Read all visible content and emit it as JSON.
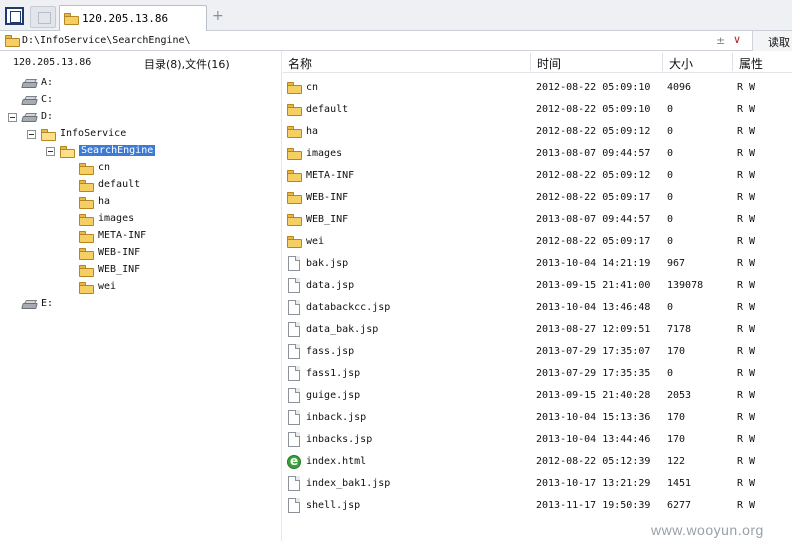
{
  "tabbar": {
    "tab_label": "120.205.13.86",
    "add_label": "+"
  },
  "address": {
    "path": "D:\\InfoService\\SearchEngine\\",
    "star": "±",
    "dropdown": "∨",
    "read_label": "读取"
  },
  "left": {
    "host": "120.205.13.86",
    "summary": "目录(8),文件(16)",
    "tree": [
      {
        "label": "A:",
        "type": "drive",
        "depth": 0,
        "expanded": false
      },
      {
        "label": "C:",
        "type": "drive",
        "depth": 0,
        "expanded": false
      },
      {
        "label": "D:",
        "type": "drive",
        "depth": 0,
        "expanded": true
      },
      {
        "label": "InfoService",
        "type": "folder",
        "depth": 1,
        "expanded": true
      },
      {
        "label": "SearchEngine",
        "type": "folder",
        "depth": 2,
        "expanded": true,
        "selected": true
      },
      {
        "label": "cn",
        "type": "folder",
        "depth": 3
      },
      {
        "label": "default",
        "type": "folder",
        "depth": 3
      },
      {
        "label": "ha",
        "type": "folder",
        "depth": 3
      },
      {
        "label": "images",
        "type": "folder",
        "depth": 3
      },
      {
        "label": "META-INF",
        "type": "folder",
        "depth": 3
      },
      {
        "label": "WEB-INF",
        "type": "folder",
        "depth": 3
      },
      {
        "label": "WEB_INF",
        "type": "folder",
        "depth": 3
      },
      {
        "label": "wei",
        "type": "folder",
        "depth": 3
      },
      {
        "label": "E:",
        "type": "drive",
        "depth": 0,
        "expanded": false
      }
    ]
  },
  "columns": {
    "name": "名称",
    "time": "时间",
    "size": "大小",
    "attr": "属性"
  },
  "files": [
    {
      "name": "cn",
      "type": "folder",
      "time": "2012-08-22 05:09:10",
      "size": "4096",
      "attr": "R W"
    },
    {
      "name": "default",
      "type": "folder",
      "time": "2012-08-22 05:09:10",
      "size": "0",
      "attr": "R W"
    },
    {
      "name": "ha",
      "type": "folder",
      "time": "2012-08-22 05:09:12",
      "size": "0",
      "attr": "R W"
    },
    {
      "name": "images",
      "type": "folder",
      "time": "2013-08-07 09:44:57",
      "size": "0",
      "attr": "R W"
    },
    {
      "name": "META-INF",
      "type": "folder",
      "time": "2012-08-22 05:09:12",
      "size": "0",
      "attr": "R W"
    },
    {
      "name": "WEB-INF",
      "type": "folder",
      "time": "2012-08-22 05:09:17",
      "size": "0",
      "attr": "R W"
    },
    {
      "name": "WEB_INF",
      "type": "folder",
      "time": "2013-08-07 09:44:57",
      "size": "0",
      "attr": "R W"
    },
    {
      "name": "wei",
      "type": "folder",
      "time": "2012-08-22 05:09:17",
      "size": "0",
      "attr": "R W"
    },
    {
      "name": "bak.jsp",
      "type": "file",
      "time": "2013-10-04 14:21:19",
      "size": "967",
      "attr": "R W"
    },
    {
      "name": "data.jsp",
      "type": "file",
      "time": "2013-09-15 21:41:00",
      "size": "139078",
      "attr": "R W"
    },
    {
      "name": "databackcc.jsp",
      "type": "file",
      "time": "2013-10-04 13:46:48",
      "size": "0",
      "attr": "R W"
    },
    {
      "name": "data_bak.jsp",
      "type": "file",
      "time": "2013-08-27 12:09:51",
      "size": "7178",
      "attr": "R W"
    },
    {
      "name": "fass.jsp",
      "type": "file",
      "time": "2013-07-29 17:35:07",
      "size": "170",
      "attr": "R W"
    },
    {
      "name": "fass1.jsp",
      "type": "file",
      "time": "2013-07-29 17:35:35",
      "size": "0",
      "attr": "R W"
    },
    {
      "name": "guige.jsp",
      "type": "file",
      "time": "2013-09-15 21:40:28",
      "size": "2053",
      "attr": "R W"
    },
    {
      "name": "inback.jsp",
      "type": "file",
      "time": "2013-10-04 15:13:36",
      "size": "170",
      "attr": "R W"
    },
    {
      "name": "inbacks.jsp",
      "type": "file",
      "time": "2013-10-04 13:44:46",
      "size": "170",
      "attr": "R W"
    },
    {
      "name": "index.html",
      "type": "ie",
      "time": "2012-08-22 05:12:39",
      "size": "122",
      "attr": "R W"
    },
    {
      "name": "index_bak1.jsp",
      "type": "file",
      "time": "2013-10-17 13:21:29",
      "size": "1451",
      "attr": "R W"
    },
    {
      "name": "shell.jsp",
      "type": "file",
      "time": "2013-11-17 19:50:39",
      "size": "6277",
      "attr": "R W"
    }
  ],
  "watermark": "www.wooyun.org"
}
